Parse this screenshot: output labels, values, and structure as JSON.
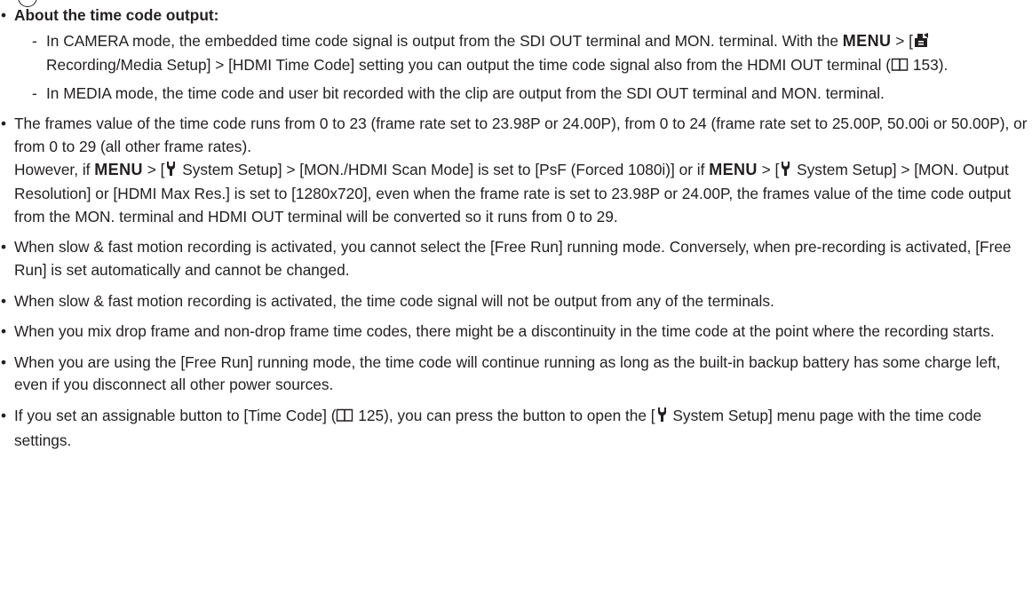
{
  "heading": "About the time code output:",
  "menu_kw": "MENU",
  "sub1": {
    "a": "In CAMERA mode, the embedded time code signal is output from the SDI OUT terminal and MON. terminal. With the ",
    "b": " > [",
    "c": " Recording/Media Setup] > [HDMI Time Code] setting you can output the time code signal also from the HDMI OUT terminal (",
    "d": " 153)."
  },
  "sub2": "In MEDIA mode, the time code and user bit recorded with the clip are output from the SDI OUT terminal and MON. terminal.",
  "b2": {
    "line1": "The frames value of the time code runs from 0 to 23 (frame rate set to 23.98P or 24.00P), from 0 to 24 (frame rate set to 25.00P, 50.00i or 50.00P), or from 0 to 29 (all other frame rates).",
    "a": "However, if ",
    "b": " > [",
    "c": " System Setup] > [MON./HDMI Scan Mode] is set to [PsF (Forced 1080i)] or if ",
    "d": " > [",
    "e": " System Setup] > [MON. Output Resolution] or [HDMI Max Res.] is set to [1280x720], even when the frame rate is set to 23.98P or 24.00P, the frames value of the time code output from the MON. terminal and HDMI OUT terminal will be converted so it runs from 0 to 29."
  },
  "b3": "When slow & fast motion recording is activated, you cannot select the [Free Run] running mode. Conversely, when pre-recording is activated, [Free Run] is set automatically and cannot be changed.",
  "b4": "When slow & fast motion recording is activated, the time code signal will not be output from any of the terminals.",
  "b5": "When you mix drop frame and non-drop frame time codes, there might be a discontinuity in the time code at the point where the recording starts.",
  "b6": "When you are using the [Free Run] running mode, the time code will continue running as long as the built-in backup battery has some charge left, even if you disconnect all other power sources.",
  "b7": {
    "a": "If you set an assignable button to [Time Code] (",
    "b": " 125), you can press the button to open the [",
    "c": " System Setup] menu page with the time code settings."
  },
  "icons": [
    "recording-media-setup-icon",
    "book-reference-icon",
    "wrench-system-setup-icon"
  ]
}
